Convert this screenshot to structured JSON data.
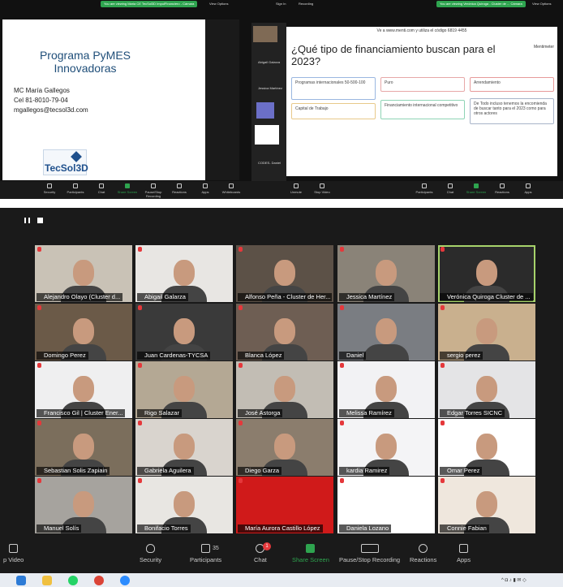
{
  "top_share": {
    "left_banner": "You are viewing Maria CE TecSol3D ImpulFinanciero - Cámara",
    "left_options": "View Options",
    "center_signin": "Sign In",
    "center_recording": "Recording",
    "right_banner": "You are viewing Verónica Quiroga - Cluster de ... Cámara",
    "right_options": "View Options",
    "slide": {
      "title": "Programa PyMES Innovadoras",
      "contact_name": "MC María Gallegos",
      "contact_phone": "Cel 81-8010-79-04",
      "contact_email": "mgallegos@tecsol3d.com",
      "logo_text": "TecSol3D"
    },
    "left_toolbar": [
      "Security",
      "Participants",
      "Chat",
      "Share Screen",
      "Pause/Stop Recording",
      "Reactions",
      "Apps",
      "Whiteboards"
    ],
    "middle_toolbar": [
      "Unmute",
      "Stop Video"
    ],
    "right_toolbar": [
      "Participants",
      "Chat",
      "Share Screen",
      "Reactions",
      "Apps"
    ],
    "side_panel": [
      "Abigail Galarza",
      "Jessica Martínez",
      "CODES- Daniel"
    ],
    "menti": {
      "header": "Ve a www.menti.com y utiliza el código 6819 4455",
      "question": "¿Qué tipo de financiamiento buscan para el 2023?",
      "brand": "Mentimeter",
      "options": [
        "Programas internacionales 50-500-100",
        "Puro",
        "Arrendamiento",
        "Capital de Trabajo",
        "Financiamiento internacional competitivo",
        "De Todo incluso tenemos la encomienda de buscar tanto para el 2023 como para otros actores"
      ]
    }
  },
  "gallery": {
    "participants": [
      "Alejandro Olayo (Cluster d...",
      "Abigail Galarza",
      "Alfonso Peña - Cluster de Her...",
      "Jessica Martínez",
      "Verónica Quiroga Cluster de ...",
      "Domingo Perez",
      "Juan Cardenas-TYCSA",
      "Blanca López",
      "Daniel",
      "sergio perez",
      "Francisco Gil | Cluster Ener...",
      "Rigo Salazar",
      "José Astorga",
      "Melissa Ramírez",
      "Edgar Torres SICNC",
      "Sebastian Solis Zapiain",
      "Gabriela Aguilera",
      "Diego Garza",
      "kardia Ramirez",
      "Omar Perez",
      "Manuel Solís",
      "Bonifacio Torres",
      "María Aurora Castillo López",
      "Daniela Lozano",
      "Connie Fabian"
    ],
    "tile_colors": [
      "#c9c2b6",
      "#e8e6e3",
      "#5c5147",
      "#8a8378",
      "#2b2b2b",
      "#6b5a48",
      "#3a3a3a",
      "#6e5e53",
      "#7a7d82",
      "#c9b08e",
      "#efeff0",
      "#b4a894",
      "#c2bdb4",
      "#f2f2f4",
      "#e4e4e6",
      "#7b6e5c",
      "#d9d4ce",
      "#8b7d6d",
      "#f4f4f6",
      "#ffffff",
      "#a6a39e",
      "#e8e6e2",
      "#d01a1a",
      "#ffffff",
      "#efe7dd"
    ],
    "toolbar": {
      "video": "p Video",
      "security": "Security",
      "participants": "Participants",
      "participants_count": "35",
      "chat": "Chat",
      "chat_badge": "1",
      "share": "Share Screen",
      "recording": "Pause/Stop Recording",
      "reactions": "Reactions",
      "apps": "Apps"
    }
  },
  "colors": {
    "zoom_green": "#2ea44f",
    "toolbar_bg": "#1a1a1a",
    "mic_red": "#e5383b",
    "selected_outline": "#a7d36b"
  }
}
